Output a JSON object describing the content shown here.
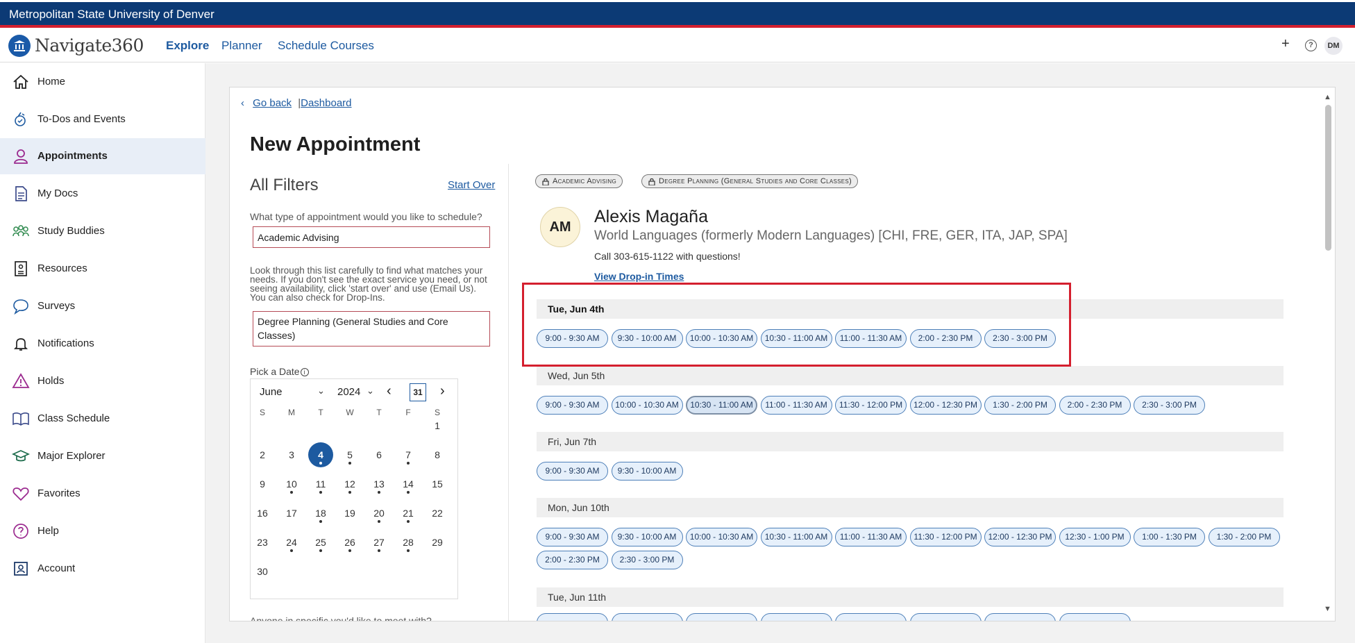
{
  "university": "Metropolitan State University of Denver",
  "app": {
    "logo_text": "Navigate360",
    "nav": [
      "Explore",
      "Planner",
      "Schedule Courses"
    ],
    "add_label": "+",
    "help_label": "?",
    "user_initials": "DM"
  },
  "sidebar": {
    "items": [
      {
        "label": "Home",
        "icon": "home-icon"
      },
      {
        "label": "To-Dos and Events",
        "icon": "todo-icon"
      },
      {
        "label": "Appointments",
        "icon": "person-icon",
        "active": true
      },
      {
        "label": "My Docs",
        "icon": "document-icon"
      },
      {
        "label": "Study Buddies",
        "icon": "group-icon"
      },
      {
        "label": "Resources",
        "icon": "resources-icon"
      },
      {
        "label": "Surveys",
        "icon": "chat-icon"
      },
      {
        "label": "Notifications",
        "icon": "bell-icon"
      },
      {
        "label": "Holds",
        "icon": "warning-icon"
      },
      {
        "label": "Class Schedule",
        "icon": "book-icon"
      },
      {
        "label": "Major Explorer",
        "icon": "graduation-cap-icon"
      },
      {
        "label": "Favorites",
        "icon": "heart-icon"
      },
      {
        "label": "Help",
        "icon": "help-icon"
      },
      {
        "label": "Account",
        "icon": "account-icon"
      }
    ]
  },
  "breadcrumb": {
    "back": "Go back",
    "separator": "|",
    "dashboard": "Dashboard"
  },
  "page_title": "New Appointment",
  "filters": {
    "title": "All Filters",
    "start_over": "Start Over",
    "type_question": "What type of appointment would you like to schedule?",
    "type_value": "Academic Advising",
    "help_text": "Look through this list carefully to find what matches your needs. If you don't see the exact service you need, or not seeing availability, click 'start over' and use (Email Us). You can also check for Drop-Ins.",
    "service_value": "Degree Planning (General Studies and Core Classes)",
    "pick_date": "Pick a Date",
    "anyone_question": "Anyone in specific you'd like to meet with?"
  },
  "calendar": {
    "month": "June",
    "year": "2024",
    "today_icon_label": "31",
    "weekdays": [
      "S",
      "M",
      "T",
      "W",
      "T",
      "F",
      "S"
    ],
    "selected_day": 4
  },
  "tags": [
    "Academic Advising",
    "Degree Planning (General Studies and Core Classes)"
  ],
  "advisor": {
    "initials": "AM",
    "name": "Alexis Magaña",
    "department": "World Languages (formerly Modern Languages) [CHI, FRE, GER, ITA, JAP, SPA]",
    "call_text": "Call 303-615-1122 with questions!",
    "drop_in_link": "View Drop-in Times"
  },
  "availability": [
    {
      "date": "Tue, Jun 4th",
      "slots": [
        "9:00 - 9:30 AM",
        "9:30 - 10:00 AM",
        "10:00 - 10:30 AM",
        "10:30 - 11:00 AM",
        "11:00 - 11:30 AM",
        "2:00 - 2:30 PM",
        "2:30 - 3:00 PM"
      ]
    },
    {
      "date": "Wed, Jun 5th",
      "slots": [
        "9:00 - 9:30 AM",
        "10:00 - 10:30 AM",
        "10:30 - 11:00 AM",
        "11:00 - 11:30 AM",
        "11:30 - 12:00 PM",
        "12:00 - 12:30 PM",
        "1:30 - 2:00 PM",
        "2:00 - 2:30 PM",
        "2:30 - 3:00 PM"
      ]
    },
    {
      "date": "Fri, Jun 7th",
      "slots": [
        "9:00 - 9:30 AM",
        "9:30 - 10:00 AM"
      ]
    },
    {
      "date": "Mon, Jun 10th",
      "slots": [
        "9:00 - 9:30 AM",
        "9:30 - 10:00 AM",
        "10:00 - 10:30 AM",
        "10:30 - 11:00 AM",
        "11:00 - 11:30 AM",
        "11:30 - 12:00 PM",
        "12:00 - 12:30 PM",
        "12:30 - 1:00 PM",
        "1:00 - 1:30 PM",
        "1:30 - 2:00 PM",
        "2:00 - 2:30 PM",
        "2:30 - 3:00 PM"
      ]
    },
    {
      "date": "Tue, Jun 11th",
      "slots": []
    }
  ],
  "colors": {
    "brand_blue": "#0c3a75",
    "accent_red": "#d41f2e",
    "link_blue": "#1d5aa0"
  }
}
